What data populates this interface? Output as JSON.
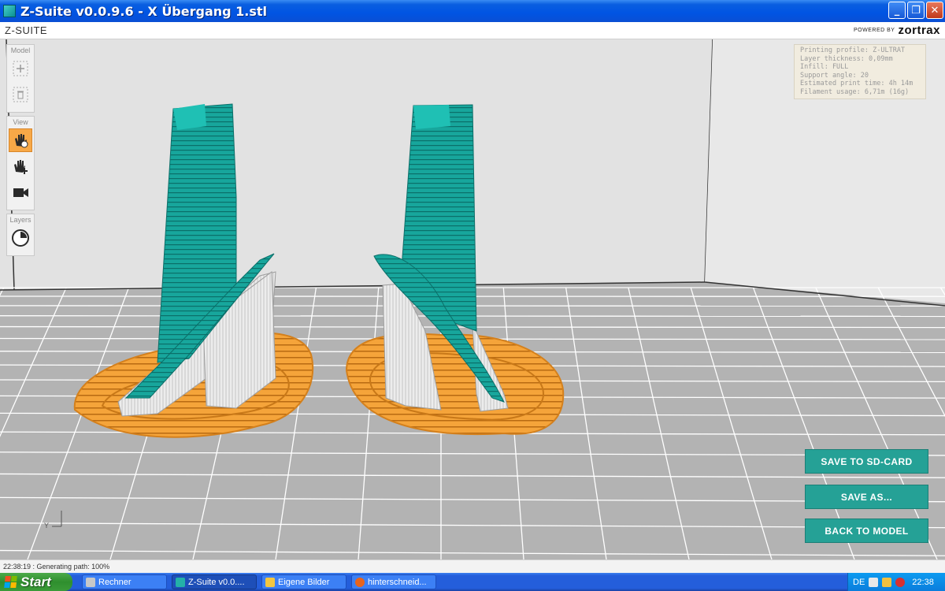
{
  "window": {
    "title": "Z-Suite v0.0.9.6 - X Übergang 1.stl"
  },
  "header": {
    "logo": "Z-SUITE",
    "powered_by": "POWERED BY",
    "brand": "zortrax"
  },
  "toolbar": {
    "groups": [
      {
        "label": "Model"
      },
      {
        "label": "View"
      },
      {
        "label": "Layers"
      }
    ]
  },
  "info": {
    "lines": [
      "Printing profile: Z-ULTRAT",
      "Layer thickness: 0,09mm",
      "Infill: FULL",
      "Support angle: 20",
      "Estimated print time: 4h 14m",
      "Filament usage: 6,71m (16g)"
    ]
  },
  "actions": {
    "save_sd": "SAVE TO SD-CARD",
    "save_as": "SAVE AS...",
    "back": "BACK TO MODEL"
  },
  "axis": {
    "label": "Y"
  },
  "status": {
    "text": "22:38:19 : Generating path: 100%"
  },
  "taskbar": {
    "start": "Start",
    "tasks": [
      {
        "label": "Rechner",
        "icon_color": "#c8c8c8"
      },
      {
        "label": "Z-Suite v0.0....",
        "icon_color": "#24b0a8"
      },
      {
        "label": "Eigene Bilder",
        "icon_color": "#f3c640"
      },
      {
        "label": "hinterschneid...",
        "icon_color": "#e8641c"
      }
    ],
    "lang": "DE",
    "clock": "22:38"
  },
  "colors": {
    "teal": "#1aa39a",
    "orange": "#f29a2a",
    "support": "#e9e9e9",
    "button": "#25a196"
  }
}
